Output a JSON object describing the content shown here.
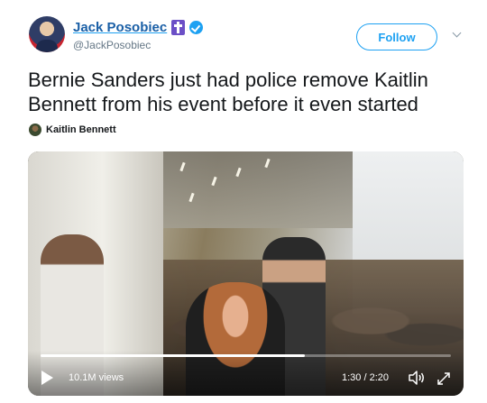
{
  "author": {
    "display_name": "Jack Posobiec",
    "handle": "@JackPosobiec",
    "badge_icon": "cross-badge-icon",
    "verified_icon": "verified-icon"
  },
  "actions": {
    "follow_label": "Follow",
    "menu_icon": "chevron-down-icon"
  },
  "tweet": {
    "text": "Bernie Sanders just had police remove Kaitlin Bennett from his event before it even started"
  },
  "media_attribution": {
    "name": "Kaitlin Bennett"
  },
  "video": {
    "views": "10.1M views",
    "time": "1:30 / 2:20",
    "progress": 0.643,
    "play_icon": "play-icon",
    "volume_icon": "volume-icon",
    "expand_icon": "expand-icon"
  },
  "colors": {
    "accent": "#1da1f2",
    "text": "#14171a",
    "secondary": "#657786"
  }
}
